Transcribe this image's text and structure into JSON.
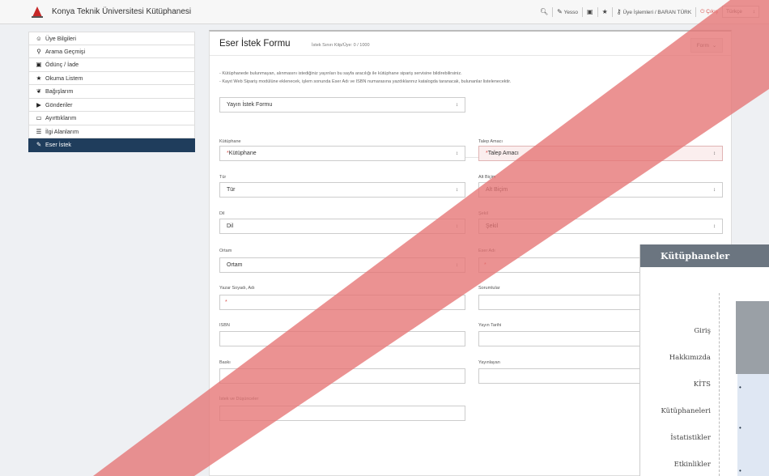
{
  "topbar": {
    "title": "Konya Teknik Üniversitesi Kütüphanesi",
    "items": {
      "vesso": "Yesso",
      "account": "Üye İşlemleri / BARAN TÜRK",
      "exit": "Çıkış",
      "language": "Türkçe"
    }
  },
  "sidebar": {
    "items": [
      {
        "label": "Üye Bilgileri",
        "icon": "user-icon"
      },
      {
        "label": "Arama Geçmişi",
        "icon": "search-icon"
      },
      {
        "label": "Ödünç / İade",
        "icon": "calendar-icon"
      },
      {
        "label": "Okuma Listem",
        "icon": "star-icon"
      },
      {
        "label": "Bağışlarım",
        "icon": "gift-icon"
      },
      {
        "label": "Gönderiler",
        "icon": "truck-icon"
      },
      {
        "label": "Ayırttıklarım",
        "icon": "inbox-icon"
      },
      {
        "label": "İlgi Alanlarım",
        "icon": "list-icon"
      },
      {
        "label": "Eser İstek",
        "icon": "edit-icon"
      }
    ]
  },
  "form": {
    "title": "Eser İstek Formu",
    "subtitle": "İstek Sınırı Kitp/Üye: 0 / 1000",
    "form_button": "Form",
    "info_line1": "- Kütüphanede bulunmayan, alınmasını istediğiniz yayınları bu sayfa aracılığı ile kütüphane sipariş servisine bildirebilirsiniz.",
    "info_line2": "- Kayıt Web Sipariş modülüne eklenecek, işlem sonunda Eser Adı ve ISBN numarasına yazdıklarınız katalogda taranacak, bulunanlar listelenecektir.",
    "type_select": "Yayın İstek Formu",
    "fields": {
      "kutuphane_label": "Kütüphane",
      "kutuphane_value": "Kütüphane",
      "talep_label": "Talep Amacı",
      "talep_value": "Talep Amacı",
      "tur_label": "Tür",
      "tur_value": "Tür",
      "alt_label": "Alt Biçim",
      "alt_value": "Alt Biçim",
      "dil_label": "Dil",
      "dil_value": "Dil",
      "sekil_label": "Şekil",
      "sekil_value": "Şekil",
      "ortam_label": "Ortam",
      "ortam_value": "Ortam",
      "eser_label": "Eser Adı",
      "yazar_label": "Yazar Soyadı, Adı",
      "sorumlular_label": "Sorumlular",
      "isbn_label": "ISBN",
      "yayin_tarihi_label": "Yayın Tarihi",
      "baski_label": "Baskı",
      "yayinlayan_label": "Yayınlayan",
      "istek_label": "İstek ve Düşünceler"
    }
  },
  "overlay": {
    "header": "Kütüphaneler",
    "nav": [
      "Giriş",
      "Hakkımızda",
      "KİTS",
      "Kütüphaneleri",
      "İstatistikler",
      "Etkinlikler"
    ]
  },
  "colors": {
    "sidebar_active": "#1f3d5c",
    "stripe": "#e57373",
    "required": "#d9534f"
  }
}
